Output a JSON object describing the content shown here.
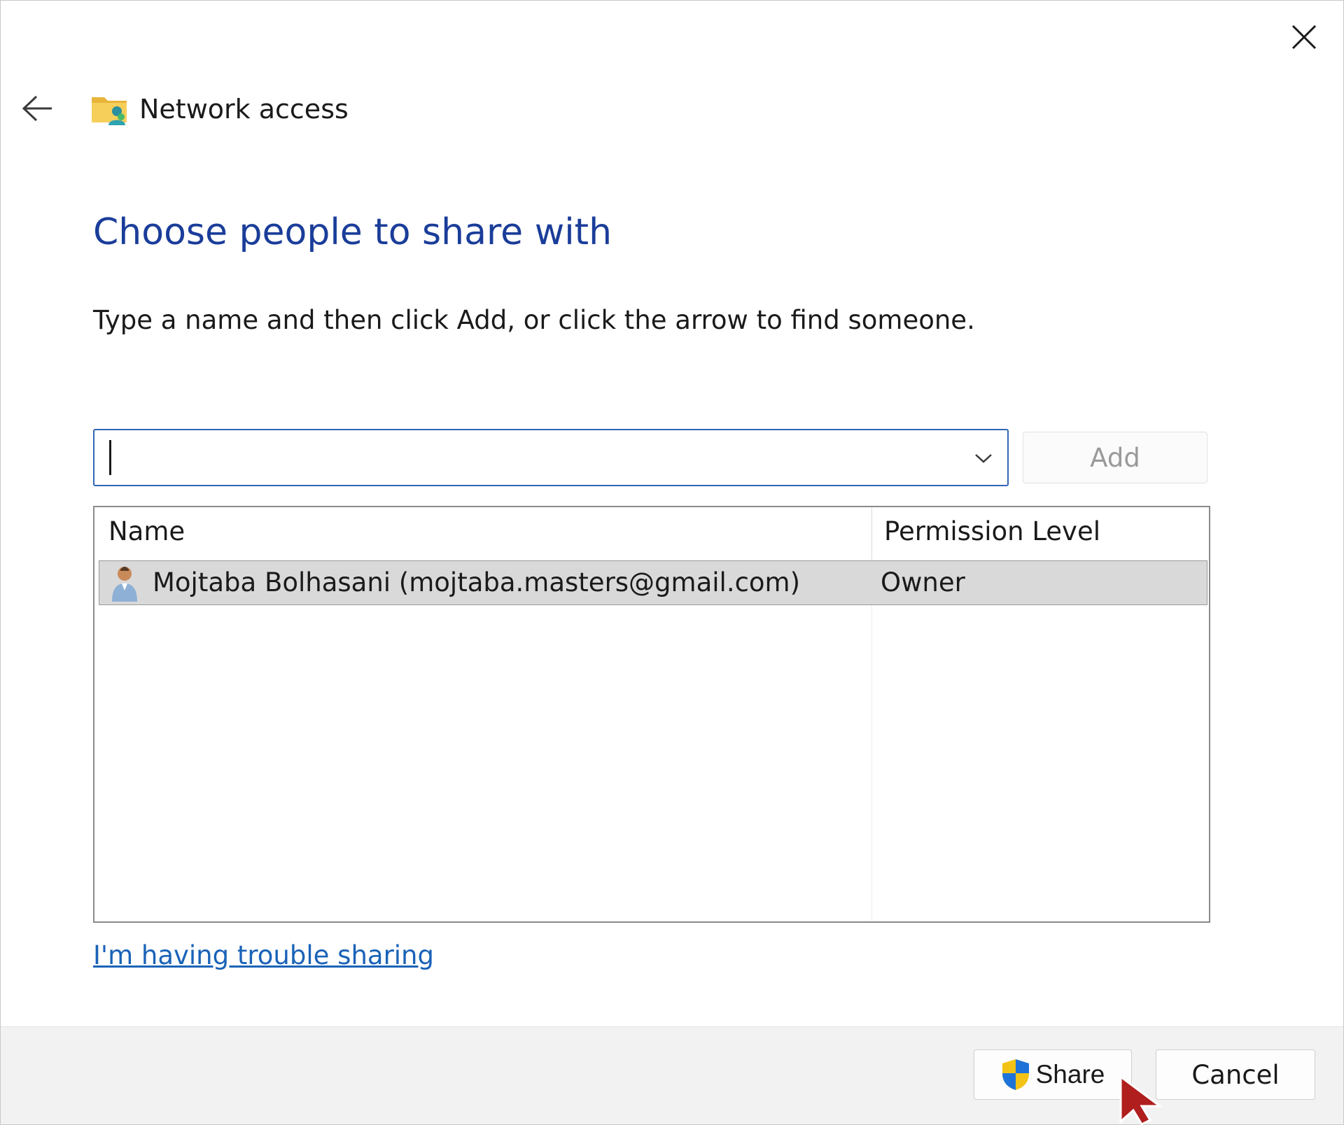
{
  "window": {
    "title": "Network access"
  },
  "heading": "Choose people to share with",
  "instruction": "Type a name and then click Add, or click the arrow to find someone.",
  "name_input": {
    "value": "",
    "placeholder": ""
  },
  "add_button_label": "Add",
  "list": {
    "columns": [
      "Name",
      "Permission Level"
    ],
    "rows": [
      {
        "name": "Mojtaba Bolhasani (mojtaba.masters@gmail.com)",
        "permission": "Owner",
        "selected": true
      }
    ]
  },
  "trouble_link": "I'm having trouble sharing",
  "footer": {
    "share_label": "Share",
    "cancel_label": "Cancel"
  },
  "icons": {
    "close": "close-icon",
    "back": "back-arrow-icon",
    "title": "network-folder-icon",
    "dropdown": "chevron-down-icon",
    "user": "user-icon",
    "uac_shield": "uac-shield-icon",
    "pointer": "mouse-pointer-icon"
  },
  "colors": {
    "heading": "#1a3d99",
    "link": "#1a63b8",
    "input_focus": "#2f66b5",
    "selected_row": "#d9d9d9",
    "footer_bg": "#f2f2f2",
    "pointer": "#b01e1e"
  }
}
